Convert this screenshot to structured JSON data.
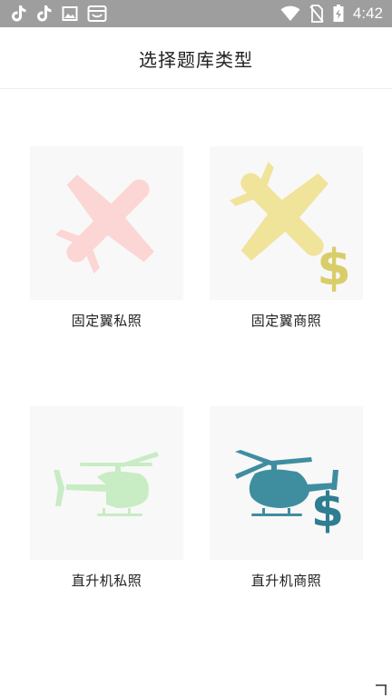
{
  "status_bar": {
    "time": "4:42",
    "left_icons": [
      "tiktok-icon",
      "tiktok-icon",
      "image-icon",
      "mailbox-icon"
    ],
    "right_icons": [
      "wifi-icon",
      "no-sim-icon",
      "battery-charging-icon"
    ]
  },
  "header": {
    "title": "选择题库类型"
  },
  "categories": [
    {
      "label": "固定翼私照",
      "icon": "airplane-icon",
      "color": "#fcd6d4"
    },
    {
      "label": "固定翼商照",
      "icon": "airplane-dollar-icon",
      "color": "#f0e39a",
      "accent": "#d9cd6a"
    },
    {
      "label": "直升机私照",
      "icon": "helicopter-icon",
      "color": "#c8ecc3"
    },
    {
      "label": "直升机商照",
      "icon": "helicopter-dollar-icon",
      "color": "#3f8ea0",
      "accent": "#2f7d91"
    }
  ]
}
